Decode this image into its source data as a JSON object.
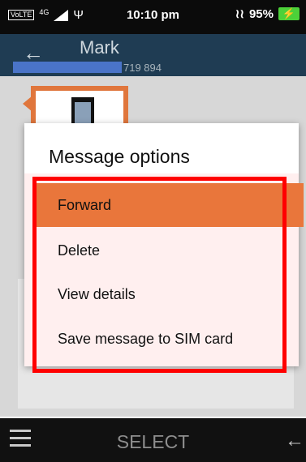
{
  "status": {
    "volte": "VoLTE",
    "network": "4G",
    "time": "10:10 pm",
    "battery": "95%",
    "usb": "Ψ"
  },
  "header": {
    "title": "Mark",
    "phone_partial": "719 894"
  },
  "dialog": {
    "title": "Message options",
    "items": [
      {
        "label": "Forward",
        "selected": true
      },
      {
        "label": "Delete",
        "selected": false
      },
      {
        "label": "View details",
        "selected": false
      },
      {
        "label": "Save message to SIM card",
        "selected": false
      }
    ]
  },
  "softkeys": {
    "center": "SELECT"
  },
  "colors": {
    "accent": "#e9763b",
    "header_bg": "#1f3c53",
    "highlight_border": "#ff0000"
  }
}
